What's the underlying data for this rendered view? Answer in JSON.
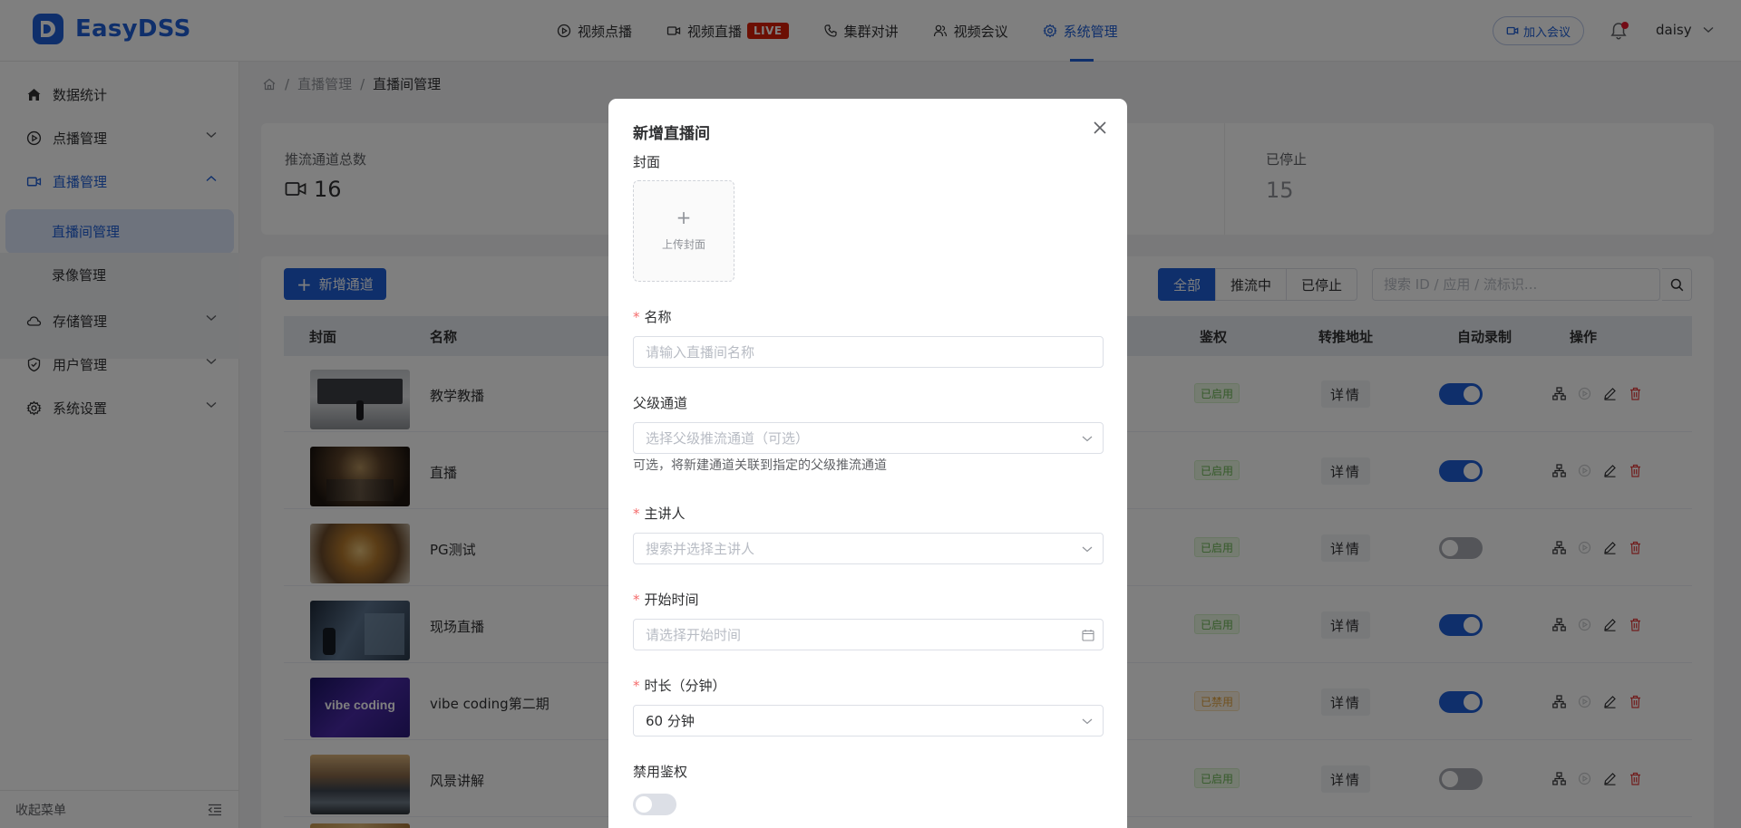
{
  "app": {
    "name": "EasyDSS",
    "brand_color": "#1f5fd6"
  },
  "nav": {
    "items": [
      {
        "label": "视频点播",
        "icon": "play-circle-icon"
      },
      {
        "label": "视频直播",
        "icon": "video-camera-icon",
        "badge": "LIVE"
      },
      {
        "label": "集群对讲",
        "icon": "phone-icon"
      },
      {
        "label": "视频会议",
        "icon": "people-icon"
      },
      {
        "label": "系统管理",
        "icon": "gear-icon",
        "active": true
      }
    ]
  },
  "header": {
    "join_meeting": "加入会议",
    "user": "daisy"
  },
  "sidebar": {
    "items": [
      {
        "label": "数据统计",
        "icon": "home-icon"
      },
      {
        "label": "点播管理",
        "icon": "play-circle-icon"
      },
      {
        "label": "直播管理",
        "icon": "video-camera-icon",
        "open": true
      },
      {
        "label": "存储管理",
        "icon": "cloud-icon"
      },
      {
        "label": "用户管理",
        "icon": "shield-icon"
      },
      {
        "label": "系统设置",
        "icon": "gear-icon"
      }
    ],
    "sub_items": [
      {
        "label": "直播间管理",
        "active": true
      },
      {
        "label": "录像管理"
      }
    ],
    "collapse_label": "收起菜单"
  },
  "breadcrumb": {
    "items": [
      "直播管理",
      "直播间管理"
    ]
  },
  "stats": {
    "total_label": "推流通道总数",
    "total_value": "16",
    "stopped_label": "已停止",
    "stopped_value": "15"
  },
  "toolbar": {
    "add_label": "新增通道",
    "filters": [
      "全部",
      "推流中",
      "已停止"
    ],
    "search_placeholder": "搜索 ID / 应用 / 流标识..."
  },
  "table": {
    "headers": {
      "cover": "封面",
      "name": "名称",
      "auth": "鉴权",
      "relay": "转推地址",
      "auto_record": "自动录制",
      "actions": "操作"
    },
    "rows": [
      {
        "name": "教学教播",
        "auth": "已启用",
        "auth_enabled": true,
        "relay": "详情",
        "auto_record": true
      },
      {
        "name": "直播",
        "auth": "已启用",
        "auth_enabled": true,
        "relay": "详情",
        "auto_record": true
      },
      {
        "name": "PG测试",
        "auth": "已启用",
        "auth_enabled": true,
        "relay": "详情",
        "auto_record": false
      },
      {
        "name": "现场直播",
        "auth": "已启用",
        "auth_enabled": true,
        "relay": "详情",
        "auto_record": true
      },
      {
        "name": "vibe coding第二期",
        "auth": "已禁用",
        "auth_enabled": false,
        "relay": "详情",
        "auto_record": true,
        "thumb_text": "vibe coding"
      },
      {
        "name": "风景讲解",
        "auth": "已启用",
        "auth_enabled": true,
        "relay": "详情",
        "auto_record": false
      }
    ]
  },
  "modal": {
    "title": "新增直播间",
    "cover_label": "封面",
    "upload_label": "上传封面",
    "name_label": "名称",
    "name_placeholder": "请输入直播间名称",
    "parent_label": "父级通道",
    "parent_placeholder": "选择父级推流通道（可选）",
    "parent_hint": "可选，将新建通道关联到指定的父级推流通道",
    "host_label": "主讲人",
    "host_placeholder": "搜索并选择主讲人",
    "start_label": "开始时间",
    "start_placeholder": "请选择开始时间",
    "duration_label": "时长（分钟）",
    "duration_value": "60 分钟",
    "disable_auth_label": "禁用鉴权"
  }
}
